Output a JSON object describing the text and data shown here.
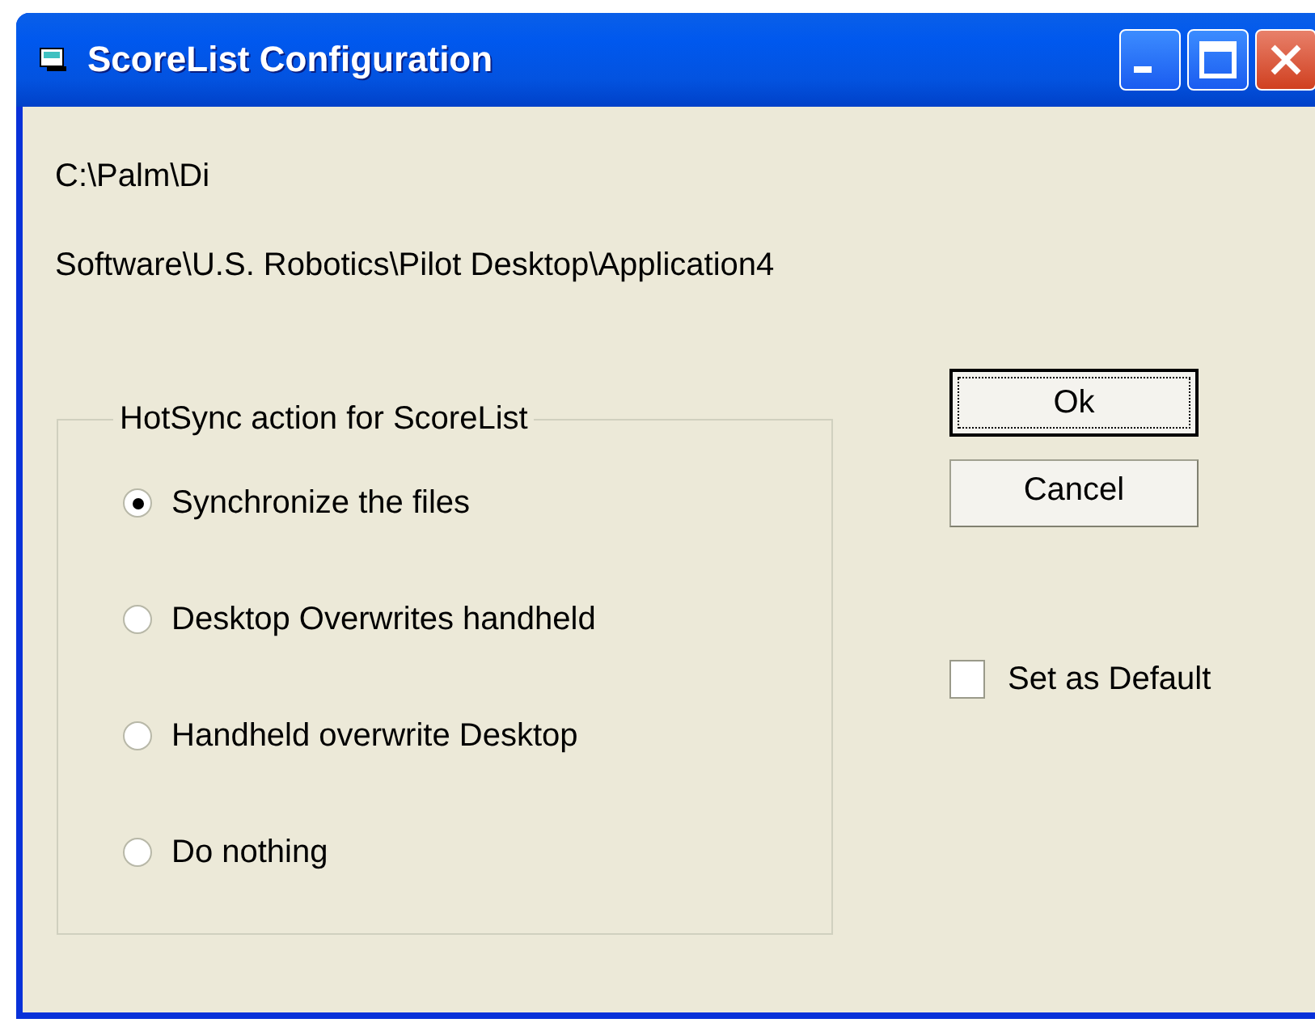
{
  "window": {
    "title": "ScoreList Configuration"
  },
  "path_text": "C:\\Palm\\Di",
  "registry_text": "Software\\U.S. Robotics\\Pilot Desktop\\Application4",
  "hotsync_group": {
    "title": "HotSync action for ScoreList",
    "options": [
      {
        "label": "Synchronize the files",
        "selected": true
      },
      {
        "label": "Desktop Overwrites handheld",
        "selected": false
      },
      {
        "label": "Handheld overwrite Desktop",
        "selected": false
      },
      {
        "label": "Do nothing",
        "selected": false
      }
    ]
  },
  "buttons": [
    {
      "label": "Ok",
      "focused": true
    },
    {
      "label": "Cancel",
      "focused": false
    }
  ],
  "set_as_default": {
    "label": "Set as Default",
    "checked": false
  }
}
